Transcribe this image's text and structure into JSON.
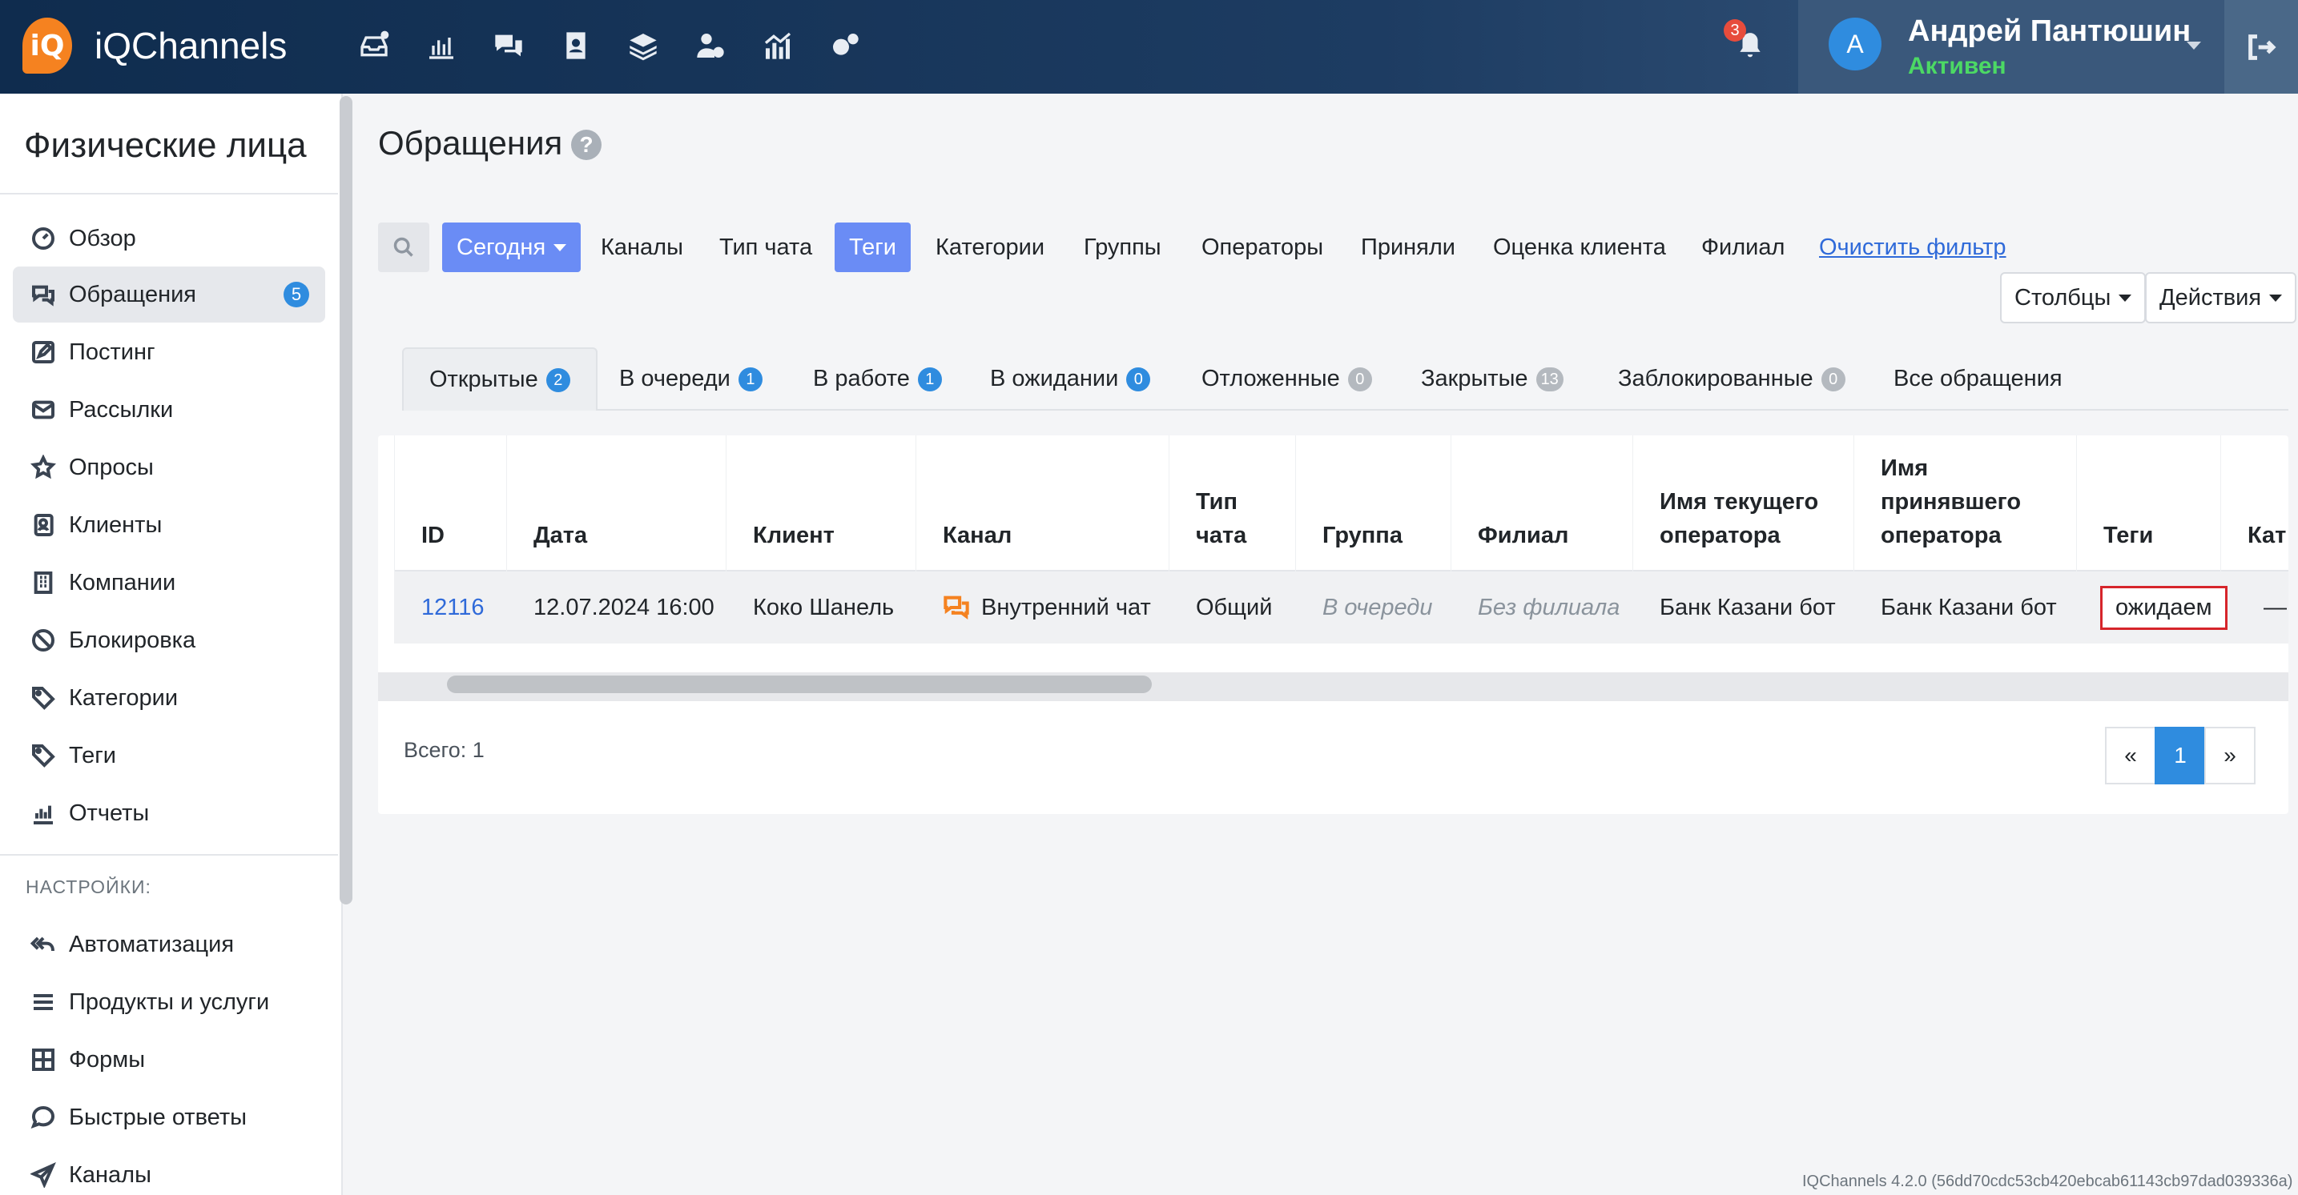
{
  "brand": {
    "logo_text": "iQ",
    "name": "iQChannels"
  },
  "topnav": {
    "icons": [
      "inbox-icon",
      "bar-chart-icon",
      "chat-bubbles-icon",
      "contacts-icon",
      "layers-icon",
      "user-settings-icon",
      "analytics-icon",
      "settings-icon"
    ],
    "notifications_count": "3"
  },
  "user": {
    "avatar_letter": "A",
    "name": "Андрей Пантюшин",
    "status": "Активен"
  },
  "sidebar": {
    "title": "Физические лица",
    "items": [
      {
        "label": "Обзор",
        "icon": "dashboard-icon"
      },
      {
        "label": "Обращения",
        "icon": "chat-icon",
        "badge": "5",
        "active": true
      },
      {
        "label": "Постинг",
        "icon": "edit-icon"
      },
      {
        "label": "Рассылки",
        "icon": "mail-icon"
      },
      {
        "label": "Опросы",
        "icon": "star-icon"
      },
      {
        "label": "Клиенты",
        "icon": "contacts-icon"
      },
      {
        "label": "Компании",
        "icon": "building-icon"
      },
      {
        "label": "Блокировка",
        "icon": "block-icon"
      },
      {
        "label": "Категории",
        "icon": "tags-icon"
      },
      {
        "label": "Теги",
        "icon": "tag-icon"
      },
      {
        "label": "Отчеты",
        "icon": "report-icon"
      }
    ],
    "settings_label": "НАСТРОЙКИ:",
    "settings_items": [
      {
        "label": "Автоматизация",
        "icon": "reply-all-icon"
      },
      {
        "label": "Продукты и услуги",
        "icon": "list-icon"
      },
      {
        "label": "Формы",
        "icon": "form-icon"
      },
      {
        "label": "Быстрые ответы",
        "icon": "quick-reply-icon"
      },
      {
        "label": "Каналы",
        "icon": "send-icon"
      }
    ]
  },
  "page": {
    "title": "Обращения",
    "help": "?"
  },
  "filters": {
    "today": "Сегодня",
    "items": [
      "Каналы",
      "Тип чата",
      "Теги",
      "Категории",
      "Группы",
      "Операторы",
      "Приняли",
      "Оценка клиента",
      "Филиал"
    ],
    "clear": "Очистить фильтр",
    "columns": "Столбцы",
    "actions": "Действия"
  },
  "tabs": [
    {
      "label": "Открытые",
      "count": "2"
    },
    {
      "label": "В очереди",
      "count": "1"
    },
    {
      "label": "В работе",
      "count": "1"
    },
    {
      "label": "В ожидании",
      "count": "0"
    },
    {
      "label": "Отложенные",
      "count": "0"
    },
    {
      "label": "Закрытые",
      "count": "13"
    },
    {
      "label": "Заблокированные",
      "count": "0"
    },
    {
      "label": "Все обращения"
    }
  ],
  "table": {
    "headers": [
      "ID",
      "Дата",
      "Клиент",
      "Канал",
      "Тип чата",
      "Группа",
      "Филиал",
      "Имя текущего оператора",
      "Имя принявшего оператора",
      "Теги",
      "Кат"
    ],
    "rows": [
      {
        "id": "12116",
        "date": "12.07.2024 16:00",
        "client": "Коко Шанель",
        "channel": "Внутренний чат",
        "chat_type": "Общий",
        "group": "В очереди",
        "branch": "Без филиала",
        "current_operator": "Банк Казани бот",
        "accepted_operator": "Банк Казани бот",
        "tags": "ожидаем",
        "category": "—"
      }
    ]
  },
  "footer": {
    "total": "Всего: 1",
    "pager": {
      "prev": "«",
      "current": "1",
      "next": "»"
    },
    "version": "IQChannels 4.2.0 (56dd70cdc53cb420ebcab61143cb97dad039336a)"
  },
  "colors": {
    "primary_button": "#6a8cf5",
    "badge_blue": "#2f8cdf",
    "highlight_border": "#d6252b",
    "status_active": "#4cd964"
  }
}
